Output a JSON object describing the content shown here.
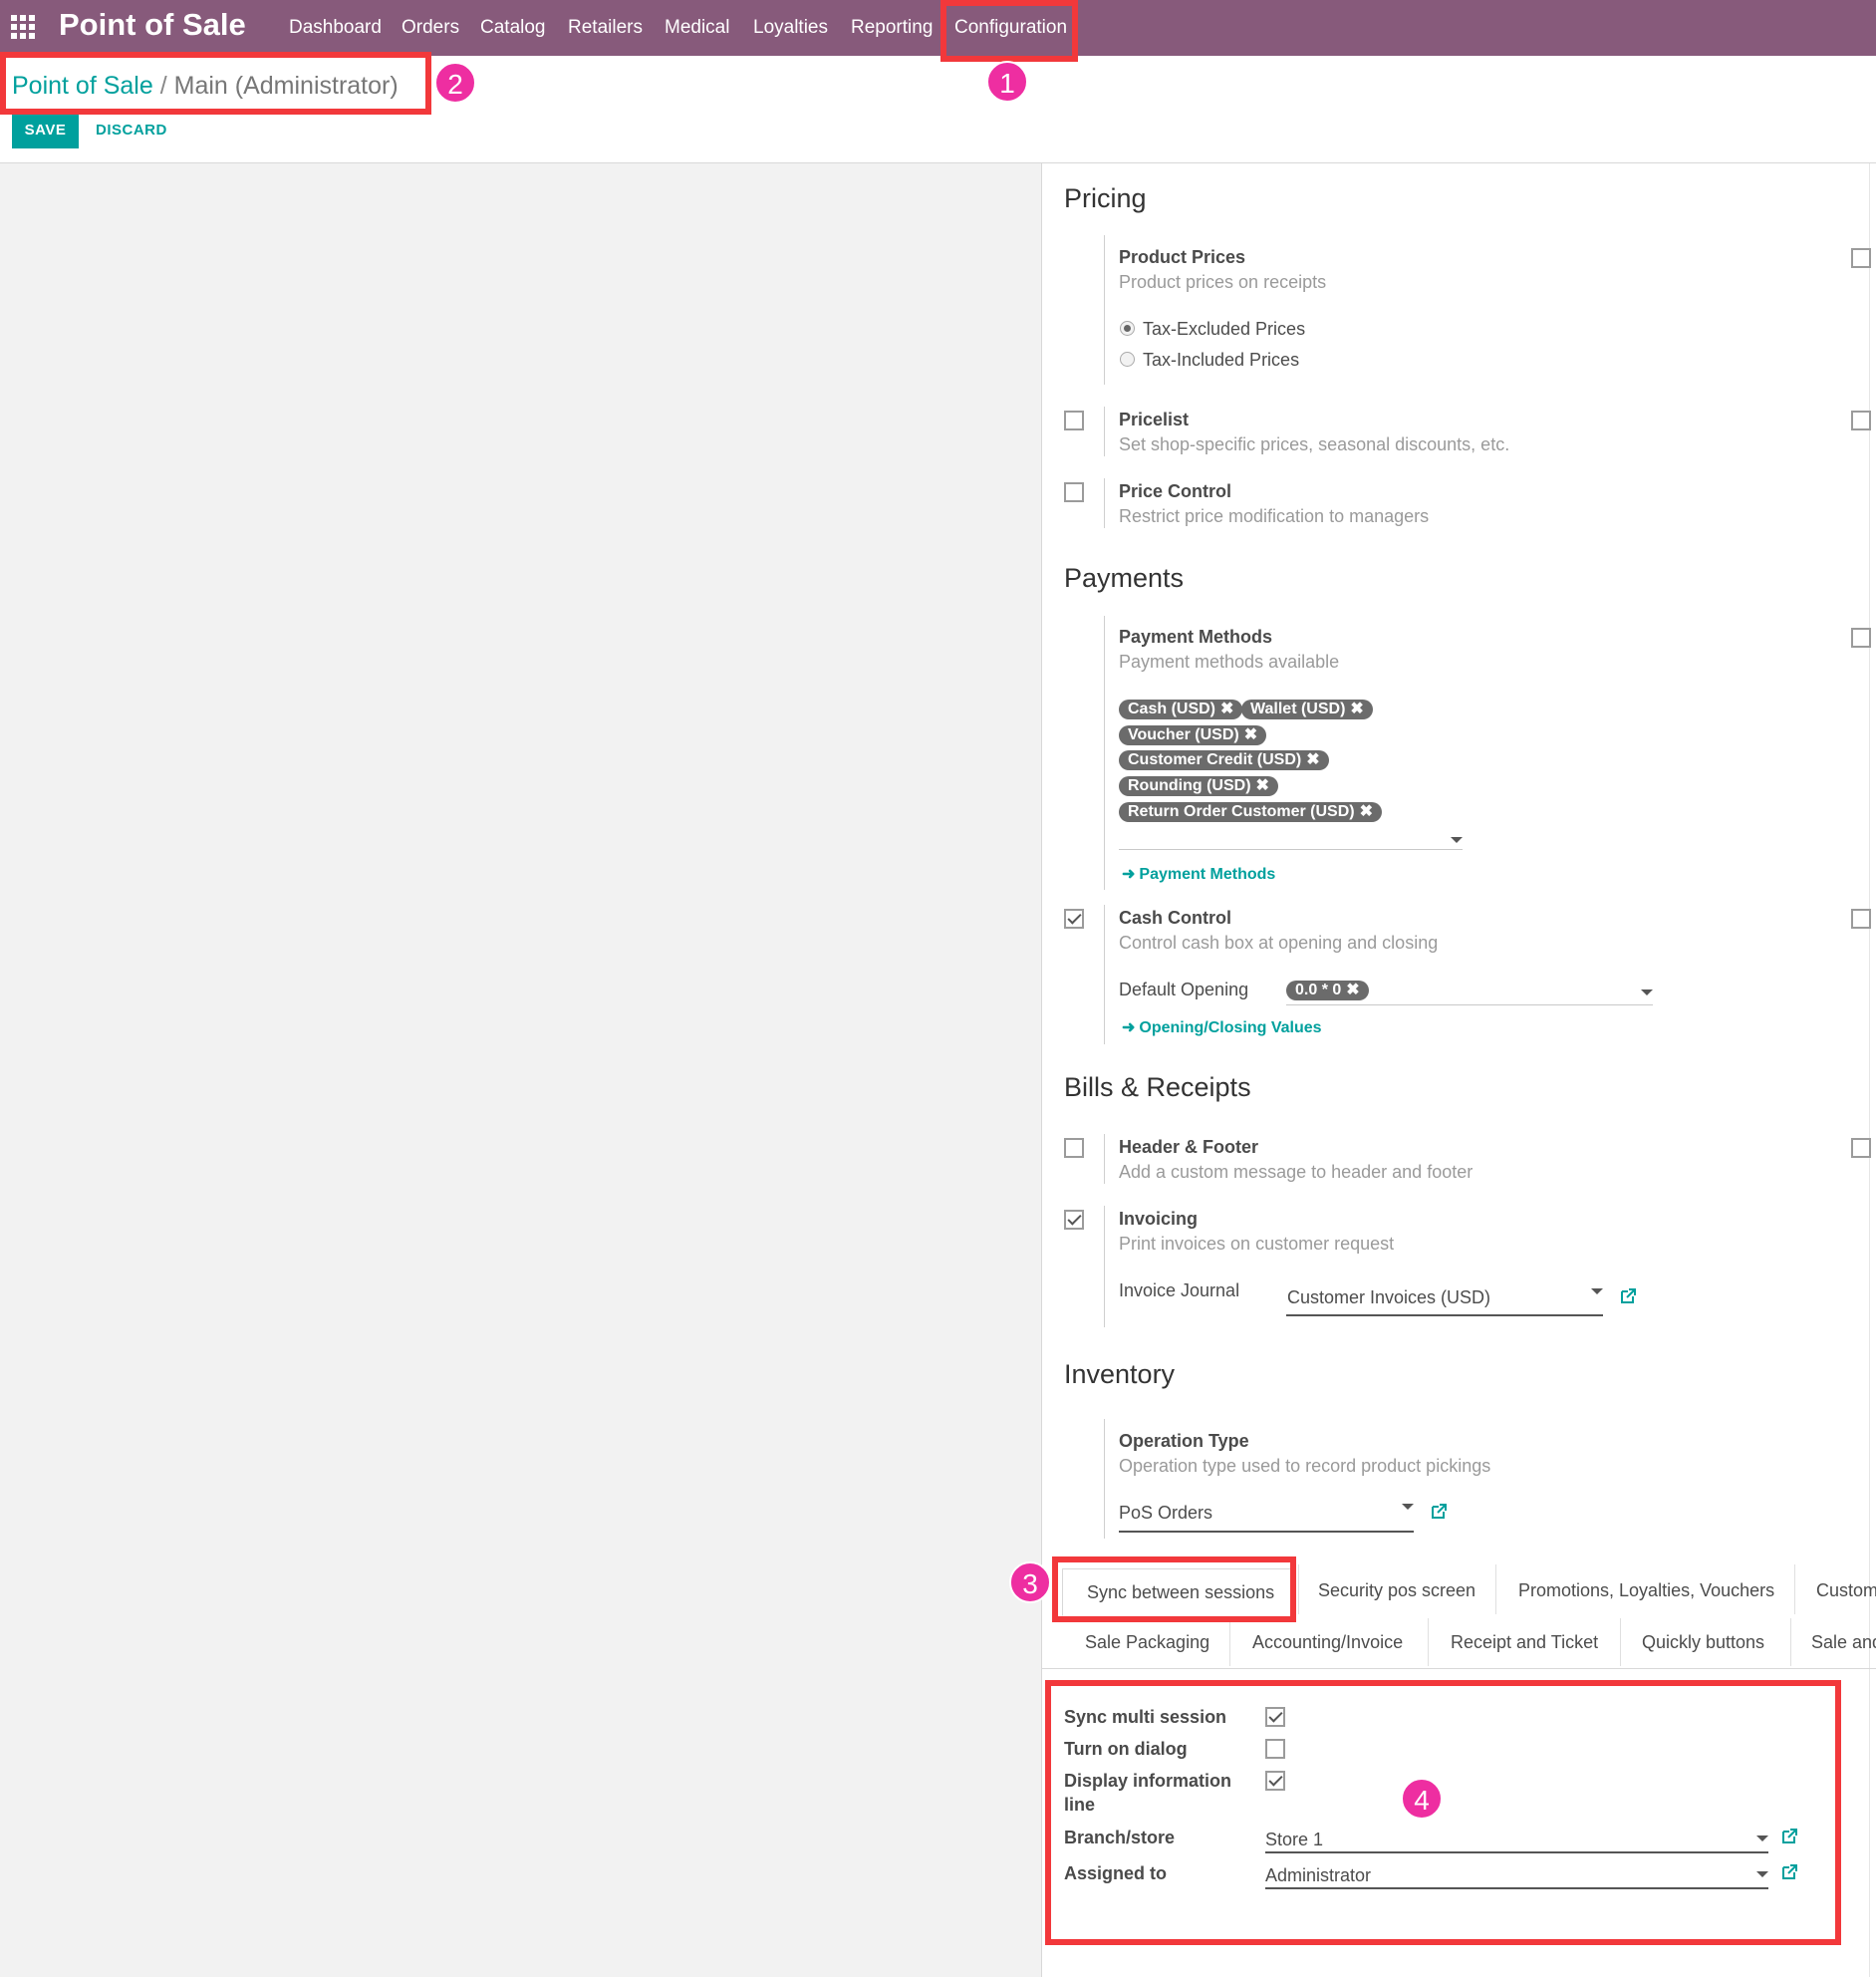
{
  "topbar": {
    "app_title": "Point of Sale",
    "apps_icon": "apps-grid-icon",
    "menu": [
      "Dashboard",
      "Orders",
      "Catalog",
      "Retailers",
      "Medical",
      "Loyalties",
      "Reporting",
      "Configuration"
    ]
  },
  "breadcrumb": {
    "root": "Point of Sale",
    "separator": "/",
    "current": "Main (Administrator)"
  },
  "buttons": {
    "save": "SAVE",
    "discard": "DISCARD"
  },
  "pricing": {
    "title": "Pricing",
    "product_prices": {
      "label": "Product Prices",
      "desc": "Product prices on receipts",
      "options": [
        "Tax-Excluded Prices",
        "Tax-Included Prices"
      ],
      "selected": "Tax-Excluded Prices"
    },
    "pricelist": {
      "label": "Pricelist",
      "desc": "Set shop-specific prices, seasonal discounts, etc.",
      "checked": false
    },
    "price_control": {
      "label": "Price Control",
      "desc": "Restrict price modification to managers",
      "checked": false
    }
  },
  "payments": {
    "title": "Payments",
    "methods": {
      "label": "Payment Methods",
      "desc": "Payment methods available",
      "tags": [
        "Cash (USD)",
        "Wallet (USD)",
        "Voucher (USD)",
        "Customer Credit (USD)",
        "Rounding (USD)",
        "Return Order Customer (USD)"
      ],
      "tag_remove_glyph": "✖",
      "link": "Payment Methods"
    },
    "cash_control": {
      "label": "Cash Control",
      "desc": "Control cash box at opening and closing",
      "checked": true,
      "default_opening_label": "Default Opening",
      "default_opening_tag": "0.0 * 0",
      "link": "Opening/Closing Values"
    }
  },
  "bills": {
    "title": "Bills & Receipts",
    "header_footer": {
      "label": "Header & Footer",
      "desc": "Add a custom message to header and footer",
      "checked": false
    },
    "invoicing": {
      "label": "Invoicing",
      "desc": "Print invoices on customer request",
      "checked": true,
      "journal_label": "Invoice Journal",
      "journal_value": "Customer Invoices (USD)"
    }
  },
  "inventory": {
    "title": "Inventory",
    "operation_type": {
      "label": "Operation Type",
      "desc": "Operation type used to record product pickings",
      "value": "PoS Orders"
    }
  },
  "tabs": {
    "row1": [
      "Sync between sessions",
      "Security pos screen",
      "Promotions, Loyalties, Vouchers",
      "Custom"
    ],
    "row2": [
      "Sale Packaging",
      "Accounting/Invoice",
      "Receipt and Ticket",
      "Quickly buttons",
      "Sale and"
    ],
    "active": "Sync between sessions"
  },
  "sync": {
    "sync_multi_session": {
      "label": "Sync multi session",
      "checked": true
    },
    "turn_on_dialog": {
      "label": "Turn on dialog",
      "checked": false
    },
    "display_info_line": {
      "label_line1": "Display information",
      "label_line2": "line",
      "checked": true
    },
    "branch_store": {
      "label": "Branch/store",
      "value": "Store 1"
    },
    "assigned_to": {
      "label": "Assigned to",
      "value": "Administrator"
    }
  },
  "annotations": {
    "badges": [
      "1",
      "2",
      "3",
      "4"
    ],
    "box_color": "#f2383b",
    "badge_color": "#ee2ea1"
  },
  "colors": {
    "topbar": "#875a7b",
    "accent": "#00a09d"
  }
}
